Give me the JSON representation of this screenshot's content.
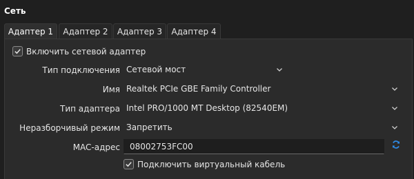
{
  "section": {
    "title": "Сеть"
  },
  "tabs": [
    {
      "label": "Адаптер 1"
    },
    {
      "label": "Адаптер 2"
    },
    {
      "label": "Адаптер 3"
    },
    {
      "label": "Адаптер 4"
    }
  ],
  "enable_adapter": {
    "label": "Включить сетевой адаптер",
    "checked": true
  },
  "fields": {
    "attached_to": {
      "label": "Тип подключения",
      "value": "Сетевой мост"
    },
    "name": {
      "label": "Имя",
      "value": "Realtek PCIe GBE Family Controller"
    },
    "adapter_type": {
      "label": "Тип адаптера",
      "value": "Intel PRO/1000 MT Desktop (82540EM)"
    },
    "promiscuous": {
      "label": "Неразборчивый режим",
      "value": "Запретить"
    },
    "mac": {
      "label": "MAC-адрес",
      "value": "08002753FC00"
    }
  },
  "cable_connected": {
    "label": "Подключить виртуальный кабель",
    "checked": true
  },
  "colors": {
    "background": "#1f1f1f",
    "panel": "#2b2b2b",
    "refresh_icon": "#2e8be6"
  },
  "icons": {
    "check": "check-icon",
    "chevron": "chevron-down-icon",
    "refresh": "refresh-icon"
  }
}
